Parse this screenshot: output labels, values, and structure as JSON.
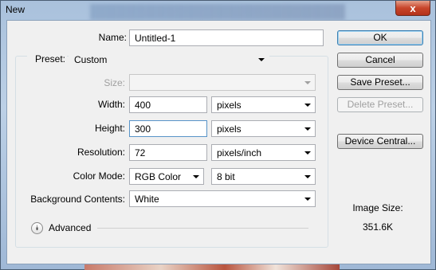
{
  "window": {
    "title": "New",
    "close_glyph": "x"
  },
  "form": {
    "name": {
      "label": "Name:",
      "value": "Untitled-1"
    },
    "preset": {
      "label": "Preset:",
      "value": "Custom"
    },
    "size": {
      "label": "Size:",
      "value": ""
    },
    "width": {
      "label": "Width:",
      "value": "400",
      "unit": "pixels"
    },
    "height": {
      "label": "Height:",
      "value": "300",
      "unit": "pixels"
    },
    "resolution": {
      "label": "Resolution:",
      "value": "72",
      "unit": "pixels/inch"
    },
    "color_mode": {
      "label": "Color Mode:",
      "value": "RGB Color",
      "depth": "8 bit"
    },
    "background": {
      "label": "Background Contents:",
      "value": "White"
    },
    "advanced": {
      "label": "Advanced",
      "icon": "chevron-double-down-icon"
    }
  },
  "buttons": {
    "ok": "OK",
    "cancel": "Cancel",
    "save_preset": "Save Preset...",
    "delete_preset": "Delete Preset...",
    "device_central": "Device Central..."
  },
  "image_size": {
    "label": "Image Size:",
    "value": "351.6K"
  }
}
